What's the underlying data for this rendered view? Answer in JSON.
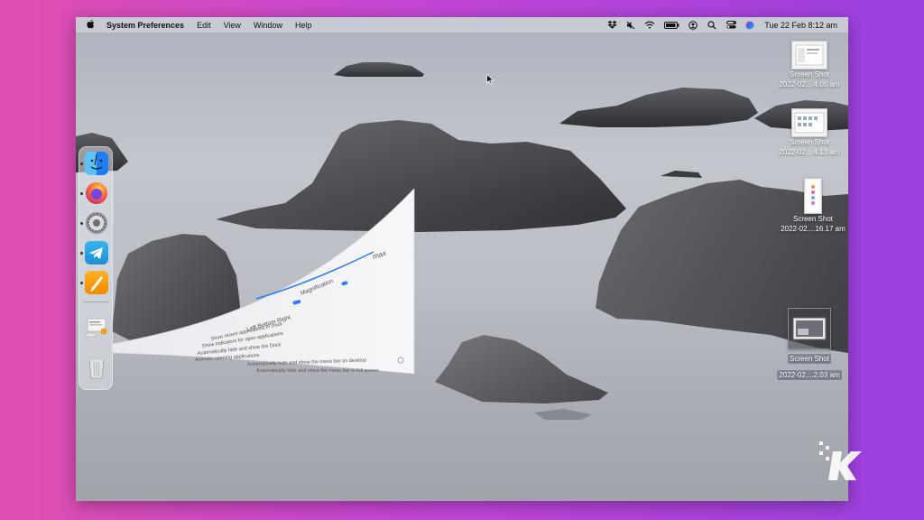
{
  "menubar": {
    "apple": "",
    "app_name": "System Preferences",
    "items": [
      "Edit",
      "View",
      "Window",
      "Help"
    ],
    "status_icons": [
      "dropbox-icon",
      "mute-icon",
      "wifi-icon",
      "battery-icon",
      "user-icon",
      "search-icon",
      "control-center-icon",
      "siri-icon"
    ],
    "datetime": "Tue 22 Feb  8:12 am"
  },
  "dock": {
    "apps": [
      "finder-icon",
      "firefox-icon",
      "system-preferences-icon",
      "telegram-icon",
      "pages-icon"
    ],
    "running": [
      "finder-icon",
      "firefox-icon",
      "system-preferences-icon",
      "telegram-icon",
      "pages-icon"
    ],
    "extras": [
      "document-stack-icon",
      "trash-icon"
    ]
  },
  "desktop_icons": [
    {
      "title": "Screen Shot",
      "subtitle": "2022-02....4.05 am"
    },
    {
      "title": "Screen Shot",
      "subtitle": "2022-02....4.13 am"
    },
    {
      "title": "Screen Shot",
      "subtitle": "2022-02....16.17 am"
    },
    {
      "title": "Screen Shot",
      "subtitle": "2022-02....2.03 am"
    }
  ],
  "genie_window": {
    "label_max": "max",
    "label_magnification": "Magnification",
    "label_left_bottom_right": "Left   Bottom   Right",
    "lines": [
      "Show recent applications in Dock",
      "Show indicators for open applications",
      "Automatically hide and show the Dock",
      "Animate opening applications",
      "Automatically hide and show the menu bar on desktop",
      "Automatically hide and show the menu bar in full screen"
    ]
  },
  "watermark": "K",
  "colors": {
    "background_left": "#e04fb0",
    "background_right": "#9a40e0",
    "menubar": "#cdd0d8",
    "accent": "#2f7cf6"
  }
}
